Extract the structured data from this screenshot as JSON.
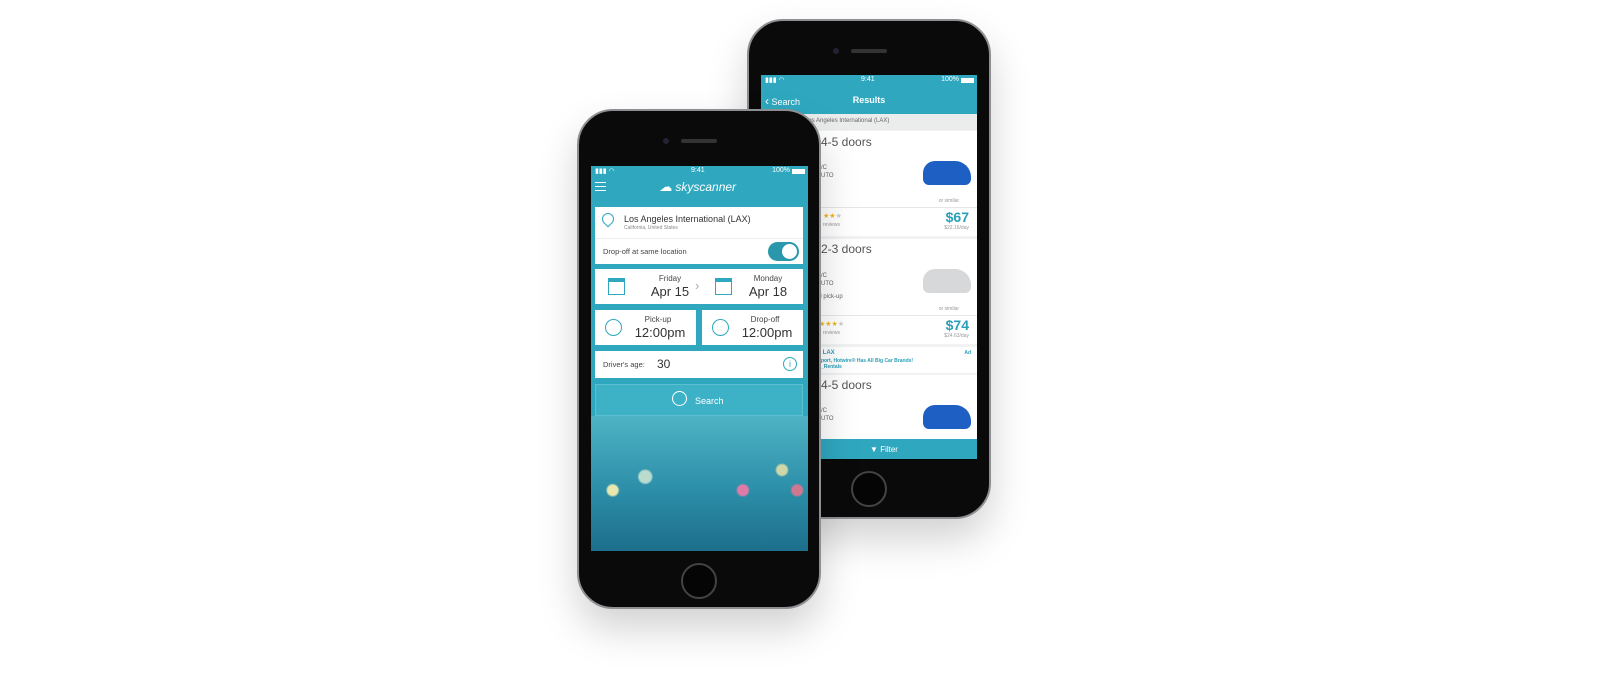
{
  "colors": {
    "accent": "#2fa8bf",
    "price": "#2a9fb8",
    "star": "#f2b51c"
  },
  "results_phone": {
    "status": {
      "time": "9:41",
      "battery": "100%"
    },
    "nav": {
      "back_label": "Search",
      "title": "Results"
    },
    "location": "Los Angeles International (LAX)",
    "cards": [
      {
        "title": "4-5 doors",
        "features": [
          "A/C",
          "AUTO"
        ],
        "note": "or similar",
        "reviews": "reviews",
        "price": "$67",
        "per_day": "$22.16/day",
        "rating": 3.5
      },
      {
        "title": "2-3 doors",
        "features": [
          "A/C",
          "AUTO"
        ],
        "extra": "al pick-up",
        "note": "or similar",
        "reviews": "reviews",
        "price": "$74",
        "per_day": "$24.63/day",
        "rating": 4
      }
    ],
    "ad": {
      "title": "- LAX",
      "line1": "rport, Hotwire® Has All Big Car Brands!",
      "line2": "r_Rentals",
      "badge": "Ad"
    },
    "card3": {
      "title": "4-5 doors",
      "features": [
        "A/C",
        "AUTO"
      ]
    },
    "filter_label": "Filter"
  },
  "search_phone": {
    "status": {
      "time": "9:41",
      "battery": "100%"
    },
    "brand": "skyscanner",
    "location": {
      "name": "Los Angeles International (LAX)",
      "sub": "California, United States"
    },
    "same_location": {
      "label": "Drop-off at same location",
      "on": true
    },
    "pickup_date": {
      "day": "Friday",
      "date": "Apr 15"
    },
    "dropoff_date": {
      "day": "Monday",
      "date": "Apr 18"
    },
    "pickup_time": {
      "label": "Pick-up",
      "time": "12:00pm"
    },
    "dropoff_time": {
      "label": "Drop-off",
      "time": "12:00pm"
    },
    "age": {
      "label": "Driver's age:",
      "value": "30"
    },
    "search_label": "Search"
  }
}
